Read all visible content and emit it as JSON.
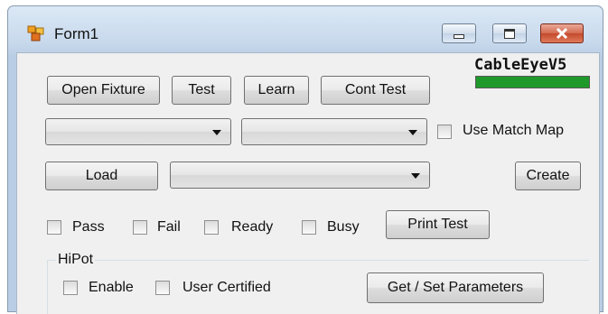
{
  "window": {
    "title": "Form1",
    "icon": "app-form-icon",
    "caption_buttons": [
      "minimize-icon",
      "maximize-icon",
      "close-icon"
    ]
  },
  "brand": {
    "text": "CableEyeV5",
    "progress_color": "#1f9a2a",
    "progress_fraction": 1.0
  },
  "toolbar": {
    "open_fixture": "Open Fixture",
    "test": "Test",
    "learn": "Learn",
    "cont_test": "Cont Test"
  },
  "row2": {
    "combo1_value": "",
    "combo2_value": "",
    "use_match_map": {
      "label": "Use Match Map",
      "checked": false
    }
  },
  "row3": {
    "load": "Load",
    "combo3_value": "",
    "create": "Create"
  },
  "status": {
    "pass": {
      "label": "Pass",
      "checked": false
    },
    "fail": {
      "label": "Fail",
      "checked": false
    },
    "ready": {
      "label": "Ready",
      "checked": false
    },
    "busy": {
      "label": "Busy",
      "checked": false
    },
    "print_test": "Print Test"
  },
  "hipot": {
    "title": "HiPot",
    "enable": {
      "label": "Enable",
      "checked": false
    },
    "user_certified": {
      "label": "User Certified",
      "checked": false
    },
    "get_set": "Get / Set Parameters"
  }
}
